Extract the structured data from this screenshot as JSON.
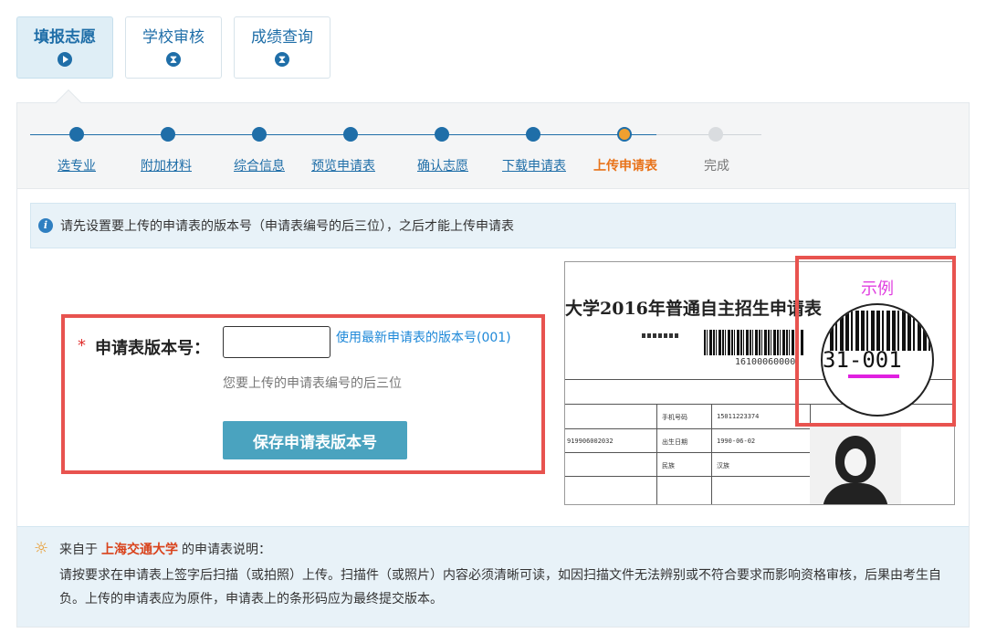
{
  "tabs": [
    {
      "label": "填报志愿",
      "icon": "play-icon"
    },
    {
      "label": "学校审核",
      "icon": "hourglass-icon"
    },
    {
      "label": "成绩查询",
      "icon": "hourglass-icon"
    }
  ],
  "steps": [
    {
      "label": "选专业",
      "state": "done"
    },
    {
      "label": "附加材料",
      "state": "done"
    },
    {
      "label": "综合信息",
      "state": "done"
    },
    {
      "label": "预览申请表",
      "state": "done"
    },
    {
      "label": "确认志愿",
      "state": "done"
    },
    {
      "label": "下载申请表",
      "state": "done"
    },
    {
      "label": "上传申请表",
      "state": "current"
    },
    {
      "label": "完成",
      "state": "todo"
    }
  ],
  "notice": {
    "text": "请先设置要上传的申请表的版本号（申请表编号的后三位），之后才能上传申请表"
  },
  "form": {
    "required_mark": "*",
    "label": "申请表版本号：",
    "value": "",
    "placeholder": "",
    "latest_link": "使用最新申请表的版本号(001)",
    "hint": "您要上传的申请表编号的后三位",
    "save_button": "保存申请表版本号"
  },
  "example": {
    "label": "示例",
    "doc_title": "大学2016年普通自主招生申请表",
    "doc_barcode_number": "16100060000",
    "doc_cells": [
      "手机号码",
      "15011223374",
      "出生日期",
      "1990-06-02",
      "民族",
      "汉族",
      "919906002032"
    ],
    "magnified_number": "31-001"
  },
  "explanation": {
    "prefix": "来自于",
    "school": "上海交通大学",
    "suffix": "的申请表说明：",
    "body": "请按要求在申请表上签字后扫描（或拍照）上传。扫描件（或照片）内容必须清晰可读，如因扫描文件无法辨别或不符合要求而影响资格审核，后果由考生自负。上传的申请表应为原件，申请表上的条形码应为最终提交版本。"
  },
  "colors": {
    "primary": "#1f6ea8",
    "current_step": "#e8731a",
    "highlight_border": "#e8534f",
    "school": "#d9421b",
    "example_label": "#e040e0"
  }
}
